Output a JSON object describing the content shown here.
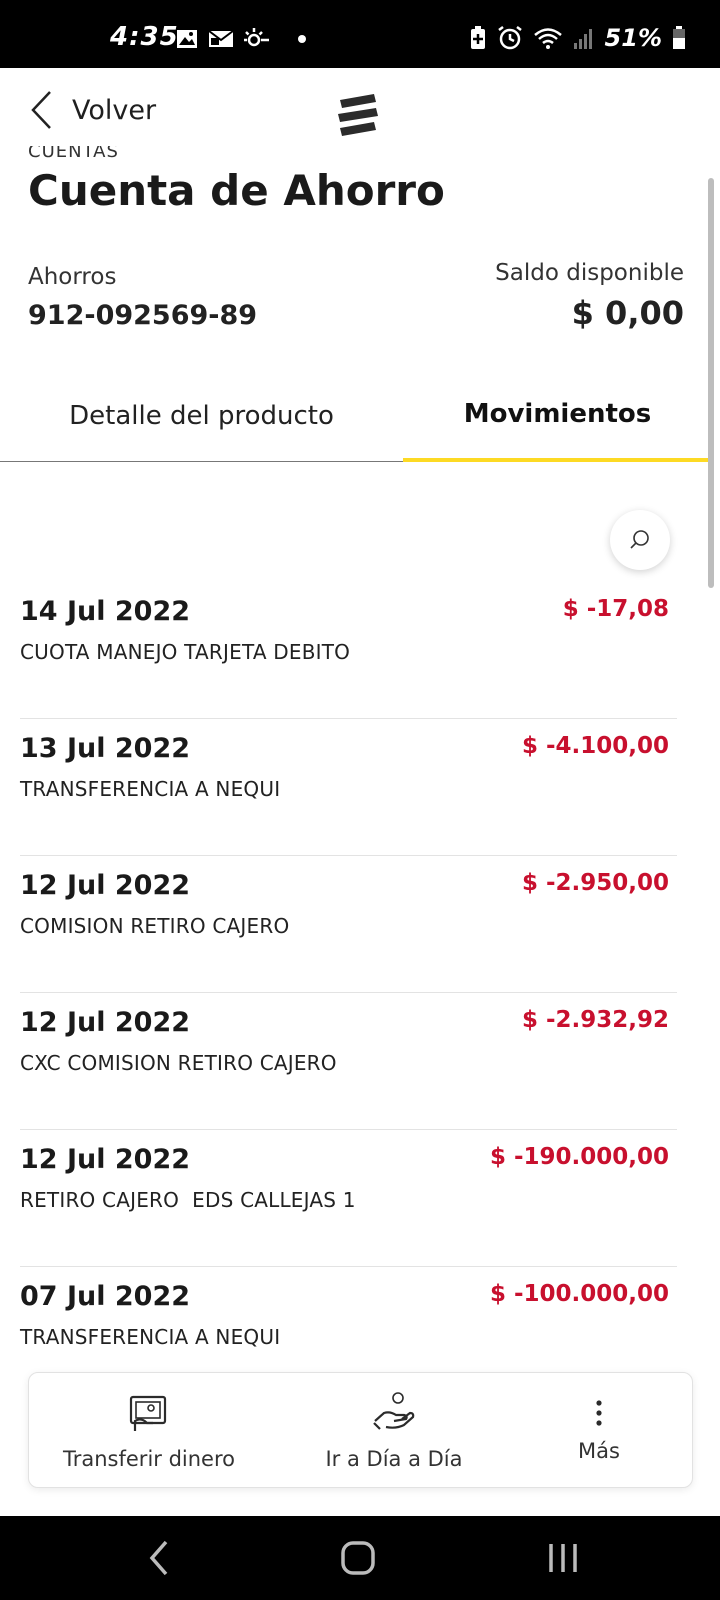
{
  "status_bar": {
    "time": "4:35",
    "battery": "51%",
    "icons": [
      "image-icon",
      "mail-icon",
      "sun-icon",
      "dot-icon",
      "battery-saver-icon",
      "alarm-icon",
      "wifi-icon",
      "signal-icon",
      "battery-icon"
    ]
  },
  "header": {
    "back_label": "Volver",
    "logo": "bancolombia-logo"
  },
  "section_label": "CUENTAS",
  "account": {
    "title": "Cuenta de Ahorro",
    "type": "Ahorros",
    "number": "912-092569-89",
    "balance_label": "Saldo disponible",
    "balance_value": "$ 0,00"
  },
  "tabs": [
    {
      "label": "Detalle del producto",
      "active": false
    },
    {
      "label": "Movimientos",
      "active": true
    }
  ],
  "movements": [
    {
      "date": "14 Jul 2022",
      "description": "CUOTA MANEJO TARJETA DEBITO",
      "amount": "$ -17,08"
    },
    {
      "date": "13 Jul 2022",
      "description": "TRANSFERENCIA A NEQUI",
      "amount": "$ -4.100,00"
    },
    {
      "date": "12 Jul 2022",
      "description": "COMISION RETIRO CAJERO",
      "amount": "$ -2.950,00"
    },
    {
      "date": "12 Jul 2022",
      "description": "CXC COMISION RETIRO CAJERO",
      "amount": "$ -2.932,92"
    },
    {
      "date": "12 Jul 2022",
      "description": "RETIRO CAJERO  EDS CALLEJAS 1",
      "amount": "$ -190.000,00"
    },
    {
      "date": "07 Jul 2022",
      "description": "TRANSFERENCIA A NEQUI",
      "amount": "$ -100.000,00"
    }
  ],
  "actions": {
    "transfer_label": "Transferir dinero",
    "dia_label": "Ir a Día a Día",
    "more_label": "Más"
  },
  "colors": {
    "accent_yellow": "#fdda24",
    "negative_red": "#c8102e"
  }
}
